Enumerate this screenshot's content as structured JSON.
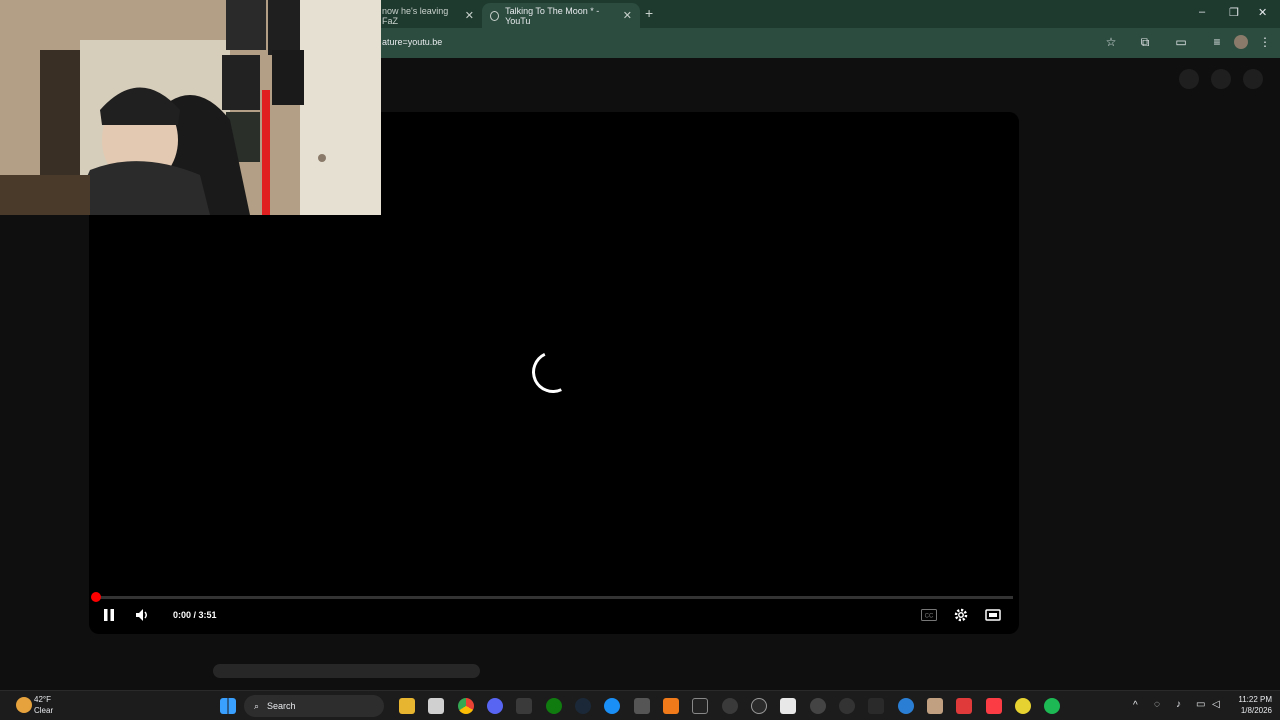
{
  "browser": {
    "tabs": [
      {
        "label": "now he's leaving FaZ",
        "active": false
      },
      {
        "label": "Talking To The Moon * - YouTu",
        "active": true
      }
    ],
    "new_tab": "+",
    "address": "ature=youtu.be",
    "window_controls": {
      "minimize": "–",
      "maximize": "❐",
      "close": "✕"
    }
  },
  "player": {
    "time": "0:00 / 3:51",
    "progress": 0.0,
    "icons": [
      "pause-icon",
      "volume-icon",
      "cc-icon",
      "settings-icon",
      "theater-icon"
    ],
    "accent": "#ff0000"
  },
  "taskbar": {
    "weather_temp": "42°F",
    "weather_cond": "Clear",
    "search_label": "Search",
    "time": "11:22 PM",
    "date": "1/8/2026"
  }
}
